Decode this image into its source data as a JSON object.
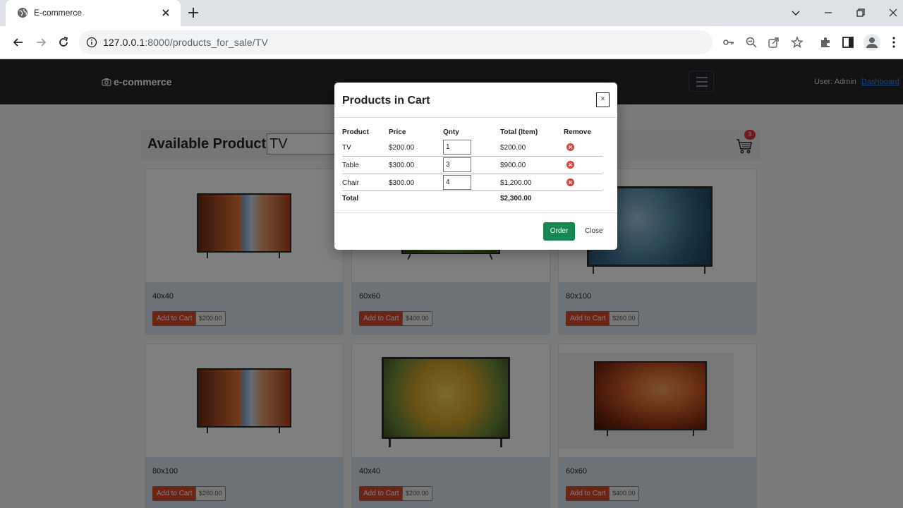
{
  "browser": {
    "tab_title": "E-commerce",
    "url_host": "127.0.0.1",
    "url_path": ":8000/products_for_sale/TV"
  },
  "navbar": {
    "brand": "e-commerce",
    "user_label": "User: Admin",
    "dashboard_link": "Dashboard"
  },
  "header": {
    "title": "Available Products",
    "filter_value": "TV",
    "cart_count": "3"
  },
  "products": [
    {
      "size": "40x40",
      "add_label": "Add to Cart",
      "price": "$200.00"
    },
    {
      "size": "60x60",
      "add_label": "Add to Cart",
      "price": "$400.00"
    },
    {
      "size": "80x100",
      "add_label": "Add to Cart",
      "price": "$260.00"
    },
    {
      "size": "80x100",
      "add_label": "Add to Cart",
      "price": "$260.00"
    },
    {
      "size": "40x40",
      "add_label": "Add to Cart",
      "price": "$200.00"
    },
    {
      "size": "60x60",
      "add_label": "Add to Cart",
      "price": "$400.00"
    }
  ],
  "cart_modal": {
    "title": "Products in Cart",
    "close_x": "×",
    "columns": {
      "product": "Product",
      "price": "Price",
      "qnty": "Qnty",
      "total": "Total (Item)",
      "remove": "Remove"
    },
    "items": [
      {
        "product": "TV",
        "price": "$200.00",
        "qnty": "1",
        "total": "$200.00"
      },
      {
        "product": "Table",
        "price": "$300.00",
        "qnty": "3",
        "total": "$900.00"
      },
      {
        "product": "Chair",
        "price": "$300.00",
        "qnty": "4",
        "total": "$1,200.00"
      }
    ],
    "total_label": "Total",
    "total_value": "$2,300.00",
    "order_button": "Order",
    "close_button": "Close"
  },
  "colors": {
    "navbar": "#212529",
    "add_button": "#d64a2e",
    "order_button": "#198754",
    "badge": "#dc3545",
    "remove_icon": "#e0433a"
  }
}
